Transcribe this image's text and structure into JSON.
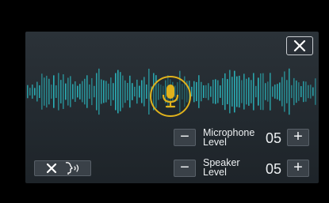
{
  "dialog": {
    "close_icon": "close-icon",
    "mic_icon": "microphone-icon",
    "accent_color": "#e0b21c",
    "wave_color": "#2bb3ba"
  },
  "controls": {
    "microphone": {
      "label": "Microphone\nLevel",
      "value": "05",
      "minus": "−",
      "plus": "+"
    },
    "speaker": {
      "label": "Speaker\nLevel",
      "value": "05",
      "minus": "−",
      "plus": "+"
    },
    "mute_icons": [
      "cross-icon",
      "speaking-head-icon"
    ]
  }
}
